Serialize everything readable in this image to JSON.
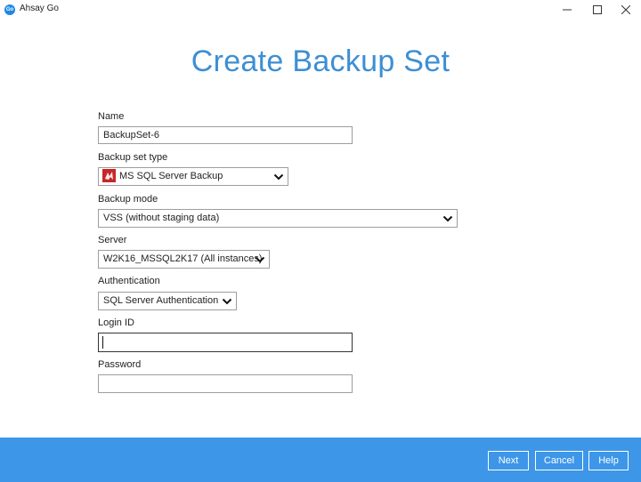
{
  "window": {
    "app_title": "Ahsay Go",
    "logo_text": "Go"
  },
  "page": {
    "title": "Create Backup Set"
  },
  "form": {
    "name": {
      "label": "Name",
      "value": "BackupSet-6"
    },
    "backup_set_type": {
      "label": "Backup set type",
      "value": "MS SQL Server Backup"
    },
    "backup_mode": {
      "label": "Backup mode",
      "value": "VSS (without staging data)"
    },
    "server": {
      "label": "Server",
      "value": "W2K16_MSSQL2K17 (All instances)"
    },
    "authentication": {
      "label": "Authentication",
      "value": "SQL Server Authentication"
    },
    "login_id": {
      "label": "Login ID",
      "value": ""
    },
    "password": {
      "label": "Password",
      "value": ""
    }
  },
  "footer": {
    "next_label": "Next",
    "cancel_label": "Cancel",
    "help_label": "Help"
  },
  "colors": {
    "accent": "#3d8fd4",
    "footer_bg": "#3d96e8",
    "sql_icon": "#c62828"
  },
  "icons": {
    "app": "ahsay-go-logo",
    "type": "mssql-server-icon",
    "dropdown": "chevron-down-icon"
  }
}
